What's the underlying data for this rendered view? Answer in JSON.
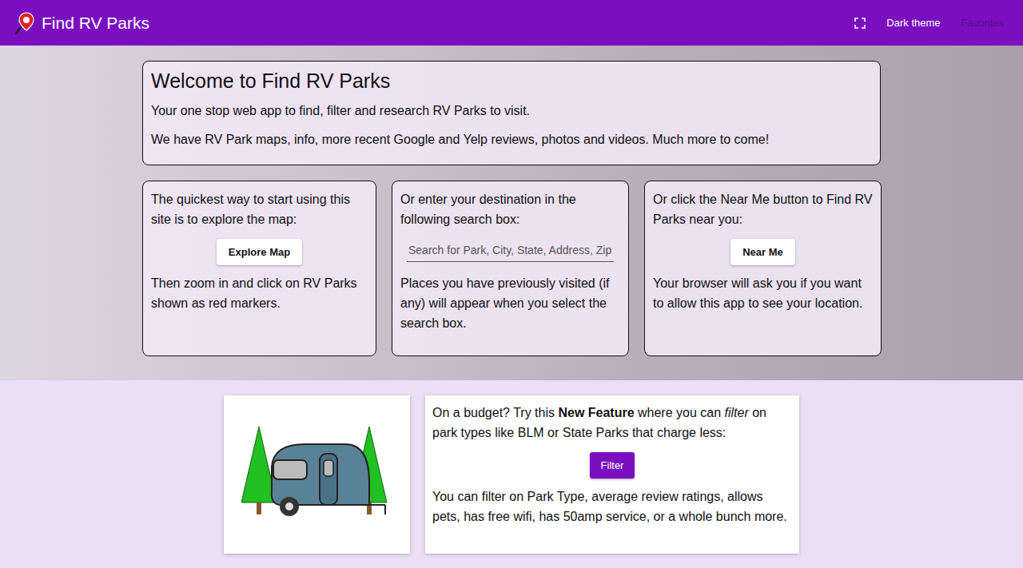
{
  "app_bar": {
    "title": "Find RV Parks",
    "actions": [
      {
        "label": "Dark theme",
        "disabled": false
      },
      {
        "label": "Favorites",
        "disabled": true
      }
    ]
  },
  "welcome": {
    "title": "Welcome to Find RV Parks",
    "paragraphs": [
      "Your one stop web app to find, filter and research RV Parks to visit.",
      "We have RV Park maps, info, more recent Google and Yelp reviews, photos and videos. Much more to come!"
    ]
  },
  "start_cards": [
    {
      "kind": "button",
      "intro": "The quickest way to start using this site is to explore the map:",
      "button": "Explore Map",
      "note": "Then zoom in and click on RV Parks shown as red markers."
    },
    {
      "kind": "search",
      "intro": "Or enter your destination in the following search box:",
      "placeholder": "Search for Park, City, State, Address, Zip",
      "note": "Places you have previously visited (if any) will appear when you select the search box."
    },
    {
      "kind": "button",
      "intro": "Or click the Near Me button to Find RV Parks near you:",
      "button": "Near Me",
      "note": "Your browser will ask you if you want to allow this app to see your location."
    }
  ],
  "feature": {
    "intro": [
      {
        "text": "On a budget? Try this ",
        "style": "normal"
      },
      {
        "text": "New Feature",
        "style": "bold"
      },
      {
        "text": " where you can ",
        "style": "normal"
      },
      {
        "text": "filter",
        "style": "italic"
      },
      {
        "text": " on park types like BLM or State Parks that charge less:",
        "style": "normal"
      }
    ],
    "button": "Filter",
    "note": "You can filter on Park Type, average review ratings, allows pets, has free wifi, has 50amp service, or a whole bunch more."
  }
}
